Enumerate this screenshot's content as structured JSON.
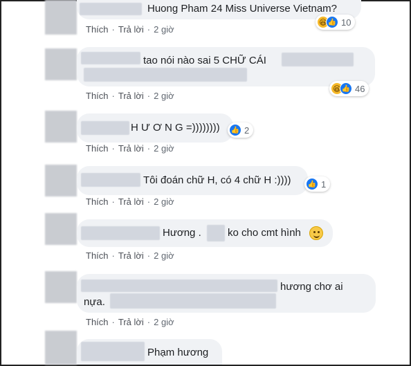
{
  "actions": {
    "like": "Thích",
    "reply": "Trả lời",
    "sep": "·",
    "time": "2 giờ"
  },
  "comments": [
    {
      "text": "Huong Pham 24 Miss Universe Vietnam?",
      "reactions": {
        "haha": true,
        "like": true,
        "count": "10"
      }
    },
    {
      "text": "tao nói nào sai 5 CHỮ CÁI",
      "reactions": {
        "haha": true,
        "like": true,
        "count": "46"
      }
    },
    {
      "text": "H Ư Ơ N G =))))))))",
      "reactions": {
        "haha": false,
        "like": true,
        "count": "2"
      }
    },
    {
      "text": "Tôi đoán chữ H, có 4 chữ H :))))",
      "reactions": {
        "haha": false,
        "like": true,
        "count": "1"
      }
    },
    {
      "text_a": "Hương .",
      "text_b": "ko cho cmt hình",
      "emoji": "slightly-smiling-face-icon"
    },
    {
      "text_a": "hương chơ ai",
      "text_b": "nựa."
    },
    {
      "text": "Phạm hương"
    }
  ],
  "colors": {
    "bubble": "#f0f2f5",
    "like_blue": "#1877f2",
    "haha_yellow": "#f7b928",
    "meta_gray": "#606770"
  }
}
